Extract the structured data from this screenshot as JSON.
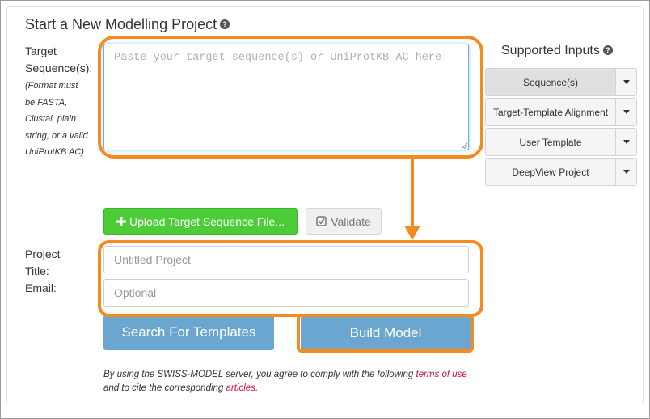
{
  "page": {
    "title": "Start a New Modelling Project",
    "help_glyph": "?"
  },
  "form": {
    "target_label_line1": "Target",
    "target_label_line2": "Sequence(s):",
    "format_hint": "(Format must be FASTA, Clustal, plain string, or a valid UniProtKB AC)",
    "sequence_placeholder": "Paste your target sequence(s) or UniProtKB AC here",
    "upload_button": "Upload Target Sequence File...",
    "validate_button": "Validate",
    "project_label_line1": "Project",
    "project_label_line2": "Title:",
    "project_placeholder": "Untitled Project",
    "email_label": "Email:",
    "email_placeholder": "Optional",
    "search_button": "Search For Templates",
    "build_button": "Build Model"
  },
  "terms": {
    "prefix": "By using the SWISS-MODEL server, you agree to comply with the following ",
    "terms_link": "terms of use",
    "middle": " and to cite the corresponding ",
    "articles_link": "articles",
    "suffix": "."
  },
  "supported_inputs": {
    "title": "Supported Inputs",
    "help_glyph": "?",
    "options": [
      {
        "label": "Sequence(s)",
        "active": true
      },
      {
        "label": "Target-Template Alignment",
        "active": false
      },
      {
        "label": "User Template",
        "active": false
      },
      {
        "label": "DeepView Project",
        "active": false
      }
    ]
  },
  "icons": {
    "help": "question-circle-icon",
    "upload": "plus-icon",
    "validate": "check-square-icon",
    "dropdown": "caret-down-icon",
    "resize": "resize-grip-icon"
  },
  "colors": {
    "highlight": "#f58a1f",
    "primary_button": "#6aa6d0",
    "success_button": "#4ccd38",
    "link": "#d0143c"
  }
}
